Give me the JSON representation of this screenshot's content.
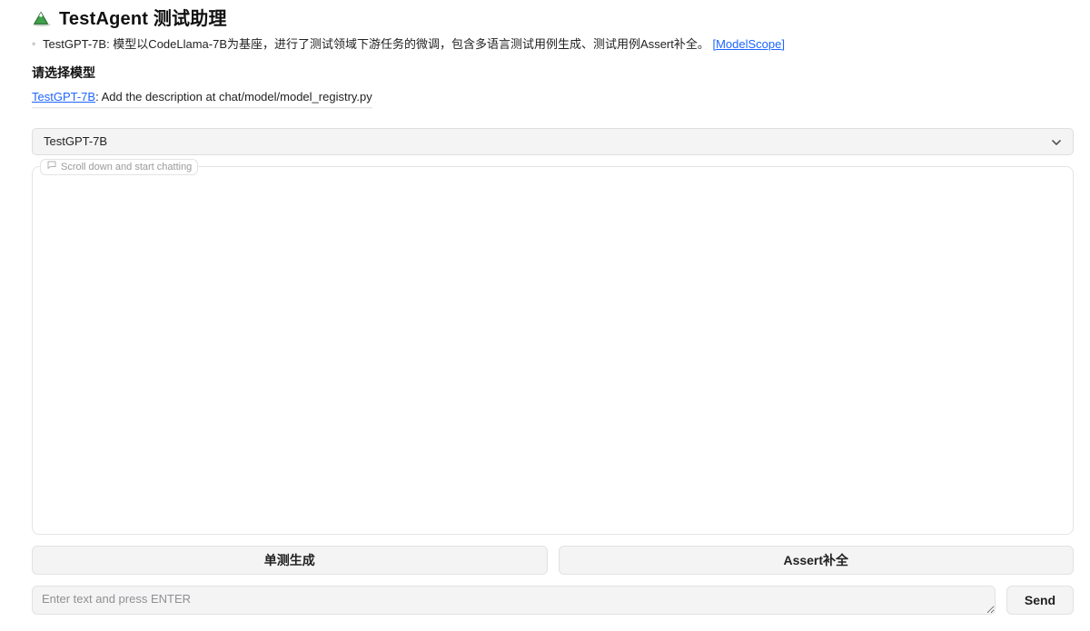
{
  "header": {
    "title": "TestAgent 测试助理"
  },
  "description": {
    "prefix": "TestGPT-7B: 模型以CodeLlama-7B为基座，进行了测试领域下游任务的微调，包含多语言测试用例生成、测试用例Assert补全。 ",
    "link_label": "[ModelScope]"
  },
  "model_section": {
    "heading": "请选择模型",
    "link_label": "TestGPT-7B",
    "desc_suffix": ": Add the description at chat/model/model_registry.py"
  },
  "select": {
    "value": "TestGPT-7B"
  },
  "chat": {
    "legend": "Scroll down and start chatting"
  },
  "actions": {
    "generate_label": "单测生成",
    "assert_label": "Assert补全"
  },
  "input": {
    "placeholder": "Enter text and press ENTER",
    "value": ""
  },
  "send": {
    "label": "Send"
  }
}
